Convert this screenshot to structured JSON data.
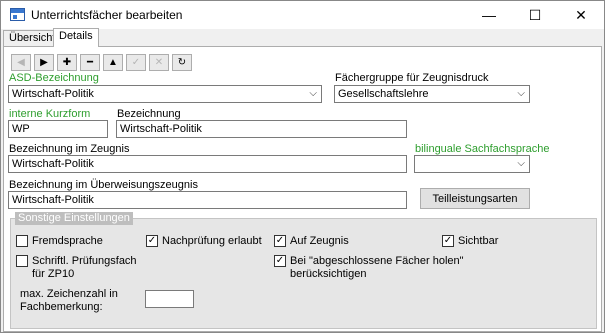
{
  "window": {
    "title": "Unterrichtsfächer bearbeiten",
    "minimize_icon": "—",
    "maximize_icon": "☐",
    "close_icon": "✕"
  },
  "tabs": [
    {
      "label": "Übersicht",
      "active": false
    },
    {
      "label": "Details",
      "active": true
    }
  ],
  "toolbar": {
    "first": "◀",
    "next": "▶",
    "add": "✚",
    "remove": "━",
    "up": "▲",
    "confirm": "✓",
    "cancel": "✕",
    "refresh": "↻"
  },
  "fields": {
    "asd_label": "ASD-Bezeichnung",
    "asd_value": "Wirtschaft-Politik",
    "faechergruppe_label": "Fächergruppe für Zeugnisdruck",
    "faechergruppe_value": "Gesellschaftslehre",
    "kurzform_label": "interne Kurzform",
    "kurzform_value": "WP",
    "bezeichnung_label": "Bezeichnung",
    "bezeichnung_value": "Wirtschaft-Politik",
    "zeugnis_label": "Bezeichnung im Zeugnis",
    "zeugnis_value": "Wirtschaft-Politik",
    "bilingual_label": "bilinguale Sachfachsprache",
    "bilingual_value": "",
    "ueberweisung_label": "Bezeichnung im Überweisungszeugnis",
    "ueberweisung_value": "Wirtschaft-Politik",
    "teilleistungsarten_button": "Teilleistungsarten",
    "dropdown_arrow": "⌵"
  },
  "colors": {
    "required_label": "#2e9e2e"
  },
  "group": {
    "title": "Sonstige Einstellungen",
    "fremdsprache": {
      "label": "Fremdsprache",
      "checked": false
    },
    "nachpruefung": {
      "label": "Nachprüfung erlaubt",
      "checked": true
    },
    "auf_zeugnis": {
      "label": "Auf Zeugnis",
      "checked": true
    },
    "sichtbar": {
      "label": "Sichtbar",
      "checked": true
    },
    "schriftl": {
      "label": "Schriftl. Prüfungsfach für ZP10",
      "checked": false
    },
    "abgeschlossene": {
      "label": "Bei \"abgeschlossene Fächer holen\" berücksichtigen",
      "checked": true
    },
    "max_zeichen_label": "max. Zeichenzahl in Fachbemerkung:",
    "max_zeichen_value": "",
    "check_mark": "✓"
  }
}
